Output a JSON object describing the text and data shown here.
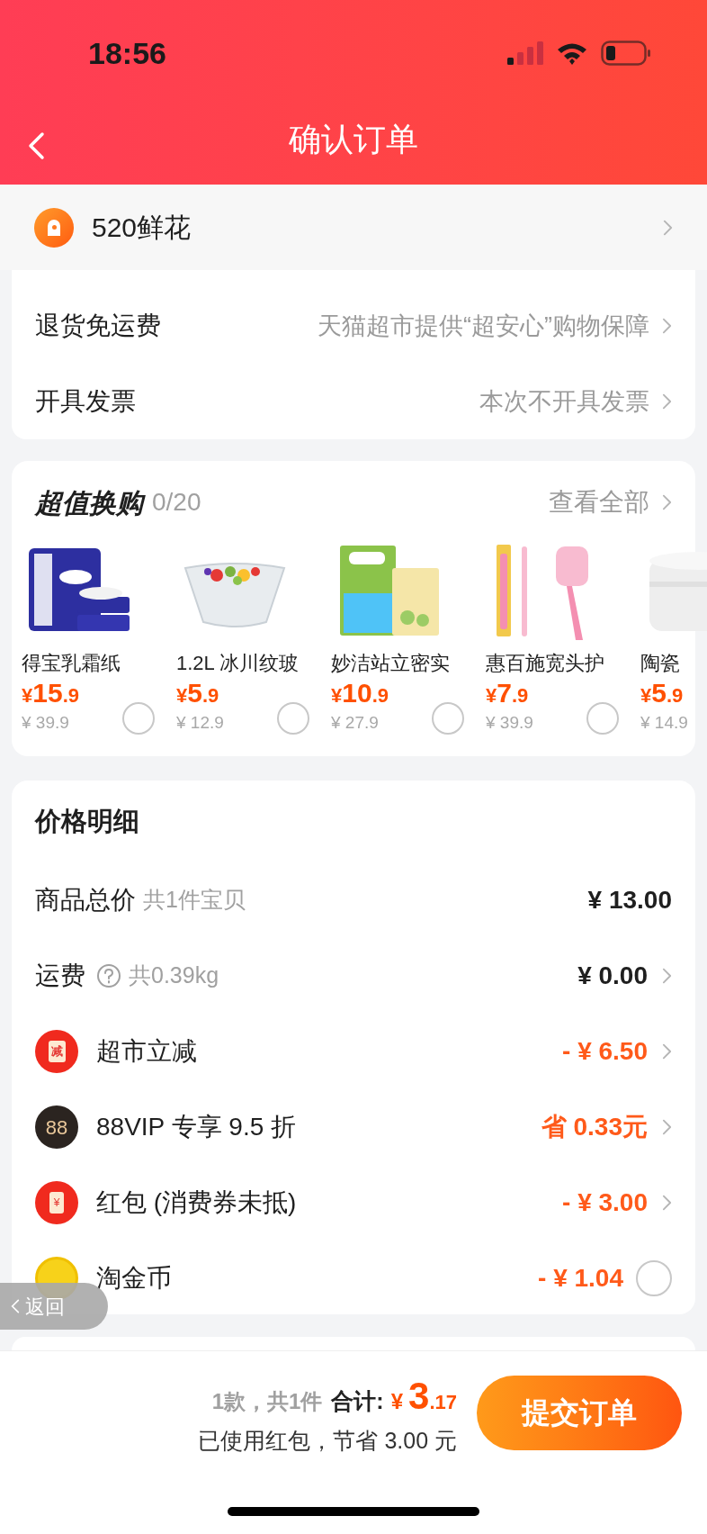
{
  "status_bar": {
    "time": "18:56"
  },
  "nav": {
    "title": "确认订单"
  },
  "address": {
    "text": "520鲜花"
  },
  "service_rows": [
    {
      "label": "退货免运费",
      "value": "天猫超市提供“超安心”购物保障"
    },
    {
      "label": "开具发票",
      "value": "本次不开具发票"
    }
  ],
  "exchange": {
    "title": "超值换购",
    "count": "0/20",
    "link": "查看全部",
    "products": [
      {
        "name": "得宝乳霜纸",
        "currency": "¥",
        "price_int": "15",
        "price_dec": ".9",
        "original_price": "¥ 39.9",
        "selected": false
      },
      {
        "name": "1.2L 冰川纹玻",
        "currency": "¥",
        "price_int": "5",
        "price_dec": ".9",
        "original_price": "¥ 12.9",
        "selected": false
      },
      {
        "name": "妙洁站立密实",
        "currency": "¥",
        "price_int": "10",
        "price_dec": ".9",
        "original_price": "¥ 27.9",
        "selected": false
      },
      {
        "name": "惠百施宽头护",
        "currency": "¥",
        "price_int": "7",
        "price_dec": ".9",
        "original_price": "¥ 39.9",
        "selected": false
      },
      {
        "name": "陶瓷",
        "currency": "¥",
        "price_int": "5",
        "price_dec": ".9",
        "original_price": "¥ 14.9"
      }
    ]
  },
  "price_detail": {
    "title": "价格明细",
    "rows": [
      {
        "kind": "total",
        "label": "商品总价",
        "note": "共1件宝贝",
        "value": "¥ 13.00"
      },
      {
        "kind": "shipping",
        "label": "运费",
        "note": "共0.39kg",
        "value": "¥ 0.00"
      },
      {
        "kind": "reduce",
        "icon_text": "减",
        "label": "超市立减",
        "value": "- ¥ 6.50"
      },
      {
        "kind": "vip",
        "icon_text": "88",
        "label": "88VIP 专享 9.5 折",
        "value": "省 0.33元"
      },
      {
        "kind": "packet",
        "icon_text": "¥",
        "label": "红包 (消费券未抵)",
        "value": "- ¥ 3.00"
      },
      {
        "kind": "coin",
        "label": "淘金币",
        "value": "- ¥ 1.04",
        "selected": false
      }
    ]
  },
  "float_back": {
    "label": "返回"
  },
  "footer": {
    "summary": "1款，共1件",
    "total_label": "合计:",
    "currency": "¥",
    "total_int": "3",
    "total_dec": ".17",
    "note": "已使用红包，节省 3.00 元",
    "submit": "提交订单"
  }
}
